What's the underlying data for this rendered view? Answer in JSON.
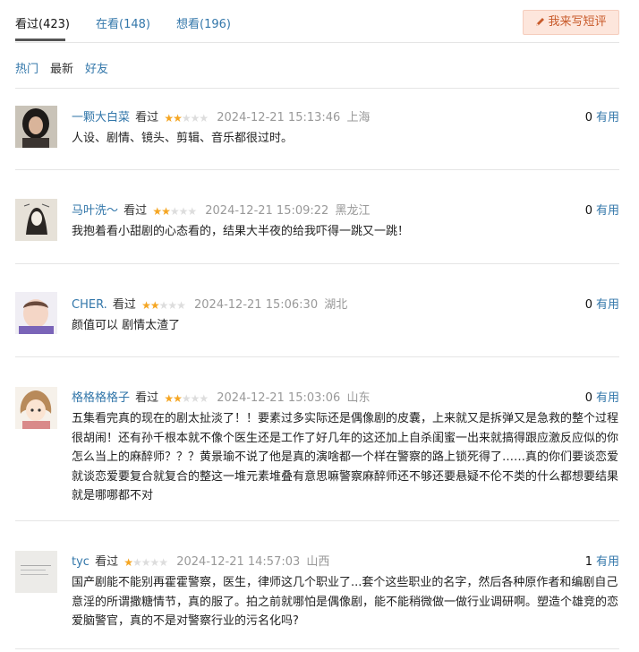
{
  "tabs": [
    {
      "label": "看过(423)"
    },
    {
      "label": "在看(148)"
    },
    {
      "label": "想看(196)"
    }
  ],
  "write_button": {
    "label": "我来写短评",
    "icon": "pencil-icon"
  },
  "filters": [
    {
      "label": "热门"
    },
    {
      "label": "最新"
    },
    {
      "label": "好友"
    }
  ],
  "vote_label": "有用",
  "colors": {
    "link": "#3377aa",
    "star": "#f5a623",
    "button_bg": "#fde6dc",
    "button_text": "#c85a2a"
  },
  "comments": [
    {
      "user": "一颗大白菜",
      "status": "看过",
      "rating": 2,
      "time": "2024-12-21 15:13:46",
      "location": "上海",
      "votes": "0",
      "text": "人设、剧情、镜头、剪辑、音乐都很过时。"
    },
    {
      "user": "马叶洗～",
      "status": "看过",
      "rating": 2,
      "time": "2024-12-21 15:09:22",
      "location": "黑龙江",
      "votes": "0",
      "text": "我抱着看小甜剧的心态看的，结果大半夜的给我吓得一跳又一跳！"
    },
    {
      "user": "CHER.",
      "status": "看过",
      "rating": 2,
      "time": "2024-12-21 15:06:30",
      "location": "湖北",
      "votes": "0",
      "text": "颜值可以 剧情太渣了"
    },
    {
      "user": "格格格格子",
      "status": "看过",
      "rating": 2,
      "time": "2024-12-21 15:03:06",
      "location": "山东",
      "votes": "0",
      "text": "五集看完真的现在的剧太扯淡了！！要素过多实际还是偶像剧的皮囊，上来就又是拆弹又是急救的整个过程很胡闹！还有孙千根本就不像个医生还是工作了好几年的这还加上自杀闺蜜一出来就搞得跟应激反应似的你怎么当上的麻醉师？？？黄景瑜不说了他是真的演啥都一个样在警察的路上锁死得了……真的你们要谈恋爱就谈恋爱要复合就复合的整这一堆元素堆叠有意思嘛警察麻醉师还不够还要悬疑不伦不类的什么都想要结果就是哪哪都不对"
    },
    {
      "user": "tyc",
      "status": "看过",
      "rating": 1,
      "time": "2024-12-21 14:57:03",
      "location": "山西",
      "votes": "1",
      "text": "国产剧能不能别再霍霍警察，医生，律师这几个职业了...套个这些职业的名字，然后各种原作者和编剧自己意淫的所谓撒糖情节，真的服了。拍之前就哪怕是偶像剧，能不能稍微做一做行业调研啊。塑造个雄竞的恋爱脑警官，真的不是对警察行业的污名化吗?"
    }
  ]
}
